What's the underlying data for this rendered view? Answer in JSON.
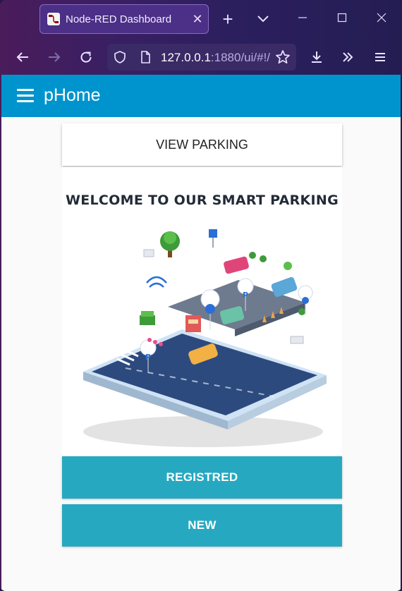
{
  "browser": {
    "tab_title": "Node-RED Dashboard",
    "url_host": "127.0.0.1",
    "url_rest": ":1880/ui/#!/"
  },
  "icons": {
    "back": "arrow-left-icon",
    "forward": "arrow-right-icon",
    "reload": "reload-icon",
    "shield": "shield-icon",
    "page": "page-icon",
    "bookmark": "star-icon",
    "downloads": "download-icon",
    "overflow": "chevron-double-right-icon",
    "menu": "menu-icon"
  },
  "colors": {
    "app_bar": "#0094ce",
    "action_button": "#26a9c0"
  },
  "app": {
    "title": "pHome",
    "view_parking_label": "VIEW PARKING",
    "welcome": "WELCOME TO OUR SMART PARKING",
    "registred_label": "REGISTRED",
    "new_label": "NEW"
  }
}
